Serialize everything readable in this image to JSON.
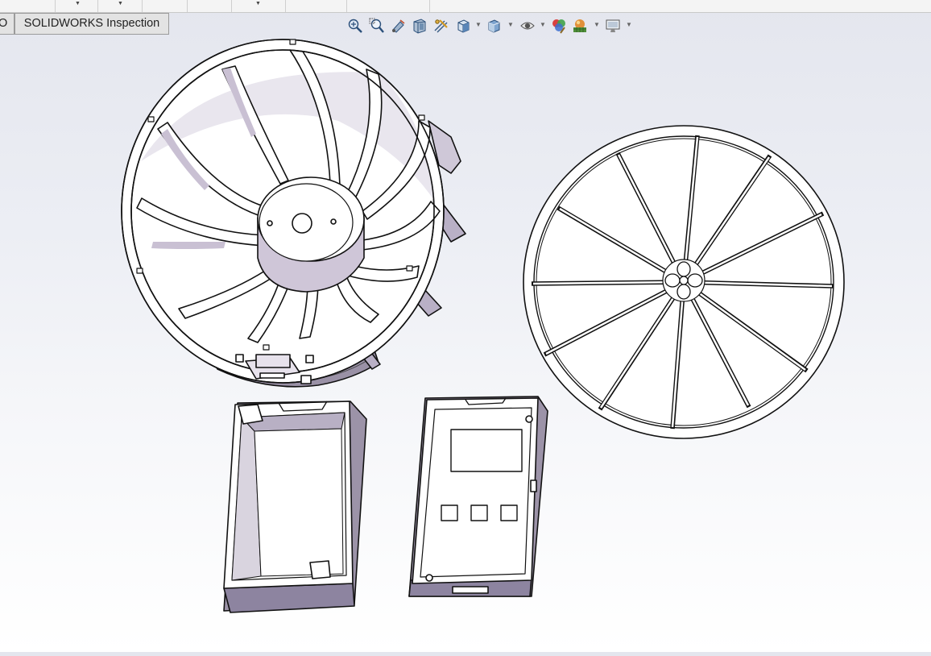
{
  "window": {
    "tab_partial_label": "O",
    "tab_active_label": "SOLIDWORKS Inspection"
  },
  "heads_up_toolbar": {
    "buttons": [
      {
        "icon": "zoom-to-fit-icon"
      },
      {
        "icon": "zoom-to-area-icon"
      },
      {
        "icon": "previous-view-icon"
      },
      {
        "icon": "section-view-icon"
      },
      {
        "icon": "dynamic-annotation-views-icon"
      },
      {
        "icon": "view-orientation-icon",
        "dropdown": true
      },
      {
        "icon": "display-style-icon",
        "dropdown": true
      },
      {
        "icon": "hide-show-items-icon",
        "dropdown": true
      },
      {
        "icon": "edit-appearance-icon"
      },
      {
        "icon": "apply-scene-icon",
        "dropdown": true
      },
      {
        "icon": "view-settings-icon",
        "dropdown": true
      }
    ]
  },
  "viewport": {
    "background_top": "#e4e6ee",
    "background_bottom": "#ffffff",
    "parts": [
      "fan-duct-housing",
      "fan-guard-grille",
      "battery-box",
      "controller-case"
    ]
  }
}
